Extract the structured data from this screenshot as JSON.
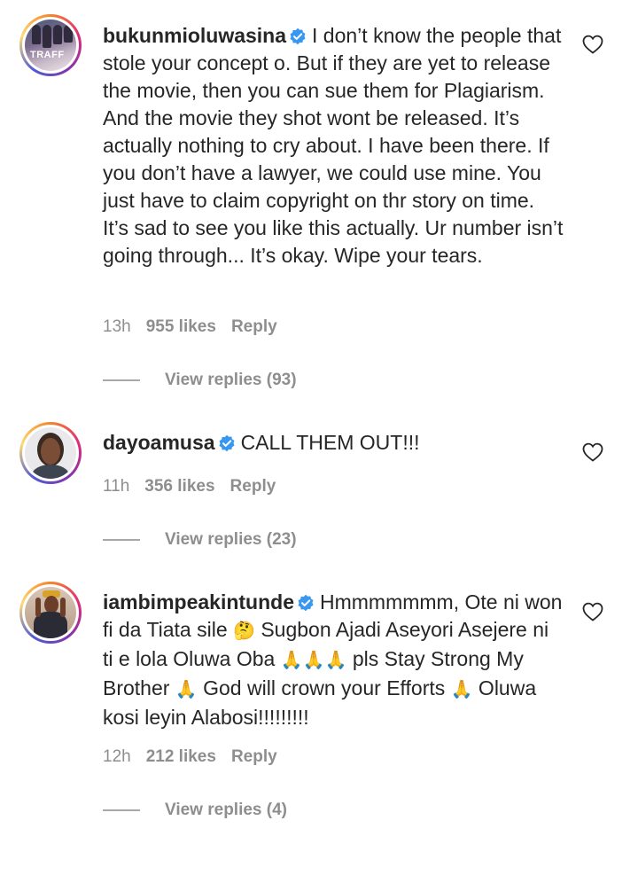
{
  "comments": [
    {
      "username": "bukunmioluwasina",
      "verified": true,
      "avatar_text": "TRAFF",
      "text": "I don’t know the people that stole your concept o. But if they are yet to release the movie, then you can sue them for Plagiarism. And the movie they shot wont be released. It’s actually nothing to cry about. I have been there. If you don’t have a lawyer, we could use mine. You just have to claim copyright on thr story on time. It’s sad to see you like this actually. Ur number isn’t going through... It’s okay. Wipe your tears.",
      "time": "13h",
      "likes": "955 likes",
      "reply": "Reply",
      "view_replies": "View replies (93)"
    },
    {
      "username": "dayoamusa",
      "verified": true,
      "text": "CALL THEM OUT!!!",
      "time": "11h",
      "likes": "356 likes",
      "reply": "Reply",
      "view_replies": "View replies (23)"
    },
    {
      "username": "iambimpeakintunde",
      "verified": true,
      "text_parts": [
        "Hmmmmmmm, Ote ni won fi da Tiata sile ",
        "🤔",
        " Sugbon Ajadi Aseyori Asejere ni ti e lola Oluwa Oba ",
        "🙏🙏🙏",
        " pls Stay Strong My Brother ",
        "🙏",
        " God will crown your Efforts ",
        "🙏",
        " Oluwa kosi leyin Alabosi!!!!!!!!!"
      ],
      "time": "12h",
      "likes": "212 likes",
      "reply": "Reply",
      "view_replies": "View replies (4)"
    }
  ],
  "colors": {
    "text": "#262626",
    "meta": "#8e8e8e",
    "verified": "#3897f0"
  },
  "icons": {
    "like": "heart-outline-icon",
    "verified": "verified-badge-icon"
  }
}
